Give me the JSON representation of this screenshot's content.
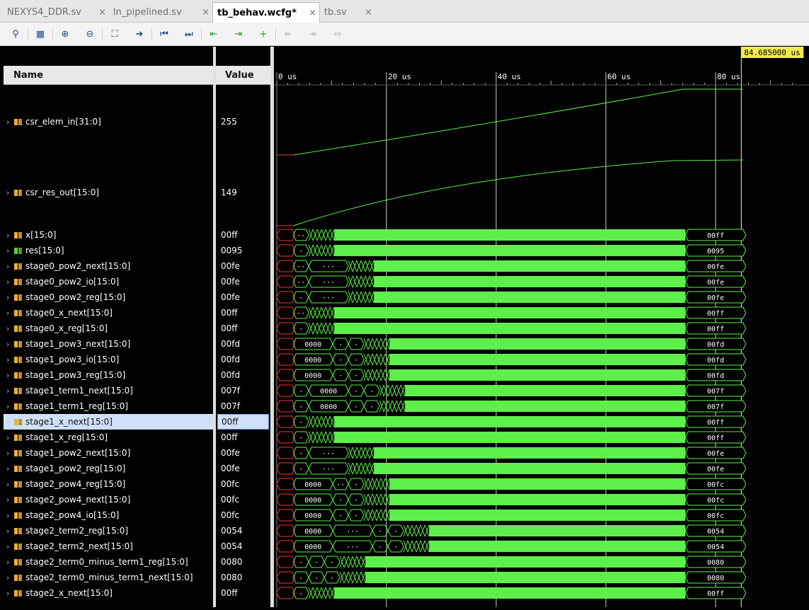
{
  "tabs": [
    {
      "label": "NEXYS4_DDR.sv",
      "close": "×"
    },
    {
      "label": "ln_pipelined.sv",
      "close": "×"
    },
    {
      "label": "tb_behav.wcfg*",
      "close": "×",
      "active": true
    },
    {
      "label": "tb.sv",
      "close": "×"
    }
  ],
  "toolbar_icons": [
    "search-icon",
    "save-icon",
    "zoom-in-icon",
    "zoom-out-icon",
    "zoom-fit-icon",
    "goto-cursor-icon",
    "goto-start-icon",
    "goto-end-icon",
    "prev-transition-icon",
    "next-transition-icon",
    "add-marker-icon",
    "prev-marker-icon",
    "next-marker-icon",
    "swap-cursors-icon"
  ],
  "header": {
    "name": "Name",
    "value": "Value",
    "cursor_time": "84.685000 us"
  },
  "timeline": {
    "ticks": [
      "0 us",
      "20 us",
      "40 us",
      "60 us",
      "80 us"
    ]
  },
  "signals": [
    {
      "name": "csr_elem_in[31:0]",
      "value": "255",
      "kind": "analog"
    },
    {
      "name": "csr_res_out[15:0]",
      "value": "149",
      "kind": "analog"
    },
    {
      "name": "x[15:0]",
      "value": "00ff"
    },
    {
      "name": "res[15:0]",
      "value": "0095",
      "icon": "res"
    },
    {
      "name": "stage0_pow2_next[15:0]",
      "value": "00fe"
    },
    {
      "name": "stage0_pow2_io[15:0]",
      "value": "00fe"
    },
    {
      "name": "stage0_pow2_reg[15:0]",
      "value": "00fe"
    },
    {
      "name": "stage0_x_next[15:0]",
      "value": "00ff"
    },
    {
      "name": "stage0_x_reg[15:0]",
      "value": "00ff"
    },
    {
      "name": "stage1_pow3_next[15:0]",
      "value": "00fd"
    },
    {
      "name": "stage1_pow3_io[15:0]",
      "value": "00fd"
    },
    {
      "name": "stage1_pow3_reg[15:0]",
      "value": "00fd"
    },
    {
      "name": "stage1_term1_next[15:0]",
      "value": "007f"
    },
    {
      "name": "stage1_term1_reg[15:0]",
      "value": "007f"
    },
    {
      "name": "stage1_x_next[15:0]",
      "value": "00ff",
      "selected": true
    },
    {
      "name": "stage1_x_reg[15:0]",
      "value": "00ff"
    },
    {
      "name": "stage1_pow2_next[15:0]",
      "value": "00fe"
    },
    {
      "name": "stage1_pow2_reg[15:0]",
      "value": "00fe"
    },
    {
      "name": "stage2_pow4_reg[15:0]",
      "value": "00fc"
    },
    {
      "name": "stage2_pow4_next[15:0]",
      "value": "00fc"
    },
    {
      "name": "stage2_pow4_io[15:0]",
      "value": "00fc"
    },
    {
      "name": "stage2_term2_reg[15:0]",
      "value": "0054"
    },
    {
      "name": "stage2_term2_next[15:0]",
      "value": "0054"
    },
    {
      "name": "stage2_term0_minus_term1_reg[15:0]",
      "value": "0080"
    },
    {
      "name": "stage2_term0_minus_term1_next[15:0]",
      "value": "0080"
    },
    {
      "name": "stage2_x_next[15:0]",
      "value": "00ff"
    }
  ],
  "waves": [
    {
      "early": [
        "··"
      ],
      "final": "00ff"
    },
    {
      "early": [
        "·"
      ],
      "final": "0095"
    },
    {
      "early": [
        "··",
        "···"
      ],
      "final": "00fe"
    },
    {
      "early": [
        "··",
        "···"
      ],
      "final": "00fe"
    },
    {
      "early": [
        "·",
        "···"
      ],
      "final": "00fe"
    },
    {
      "early": [
        "··"
      ],
      "final": "00ff"
    },
    {
      "early": [
        "·"
      ],
      "final": "00ff"
    },
    {
      "early": [
        "0000",
        "·",
        "·"
      ],
      "final": "00fd"
    },
    {
      "early": [
        "0000",
        "·",
        "·"
      ],
      "final": "00fd"
    },
    {
      "early": [
        "0000",
        "·",
        "·"
      ],
      "final": "00fd"
    },
    {
      "early": [
        "·",
        "0000",
        "·",
        "·"
      ],
      "final": "007f"
    },
    {
      "early": [
        "·",
        "0000",
        "·",
        "·"
      ],
      "final": "007f"
    },
    {
      "early": [
        "·"
      ],
      "final": "00ff"
    },
    {
      "early": [
        "·"
      ],
      "final": "00ff"
    },
    {
      "early": [
        "·",
        "···"
      ],
      "final": "00fe"
    },
    {
      "early": [
        "·",
        "···"
      ],
      "final": "00fe"
    },
    {
      "early": [
        "0000",
        "··",
        "·"
      ],
      "final": "00fc"
    },
    {
      "early": [
        "0000",
        "·",
        "·"
      ],
      "final": "00fc"
    },
    {
      "early": [
        "0000",
        "·",
        "·"
      ],
      "final": "00fc"
    },
    {
      "early": [
        "0000",
        "···",
        "·",
        "·"
      ],
      "final": "0054"
    },
    {
      "early": [
        "0000",
        "···",
        "·",
        "·"
      ],
      "final": "0054"
    },
    {
      "early": [
        "·",
        "·",
        "·"
      ],
      "final": "0080"
    },
    {
      "early": [
        "·",
        "·",
        "·"
      ],
      "final": "0080"
    },
    {
      "early": [
        "·"
      ],
      "final": "00ff"
    }
  ]
}
